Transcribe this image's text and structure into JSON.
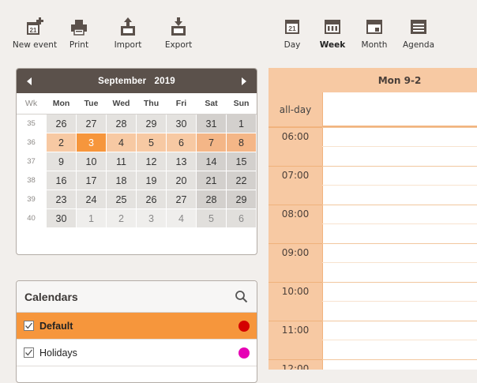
{
  "toolbar_left": [
    {
      "name": "new-event-button",
      "icon": "new-event-icon",
      "label": "New event"
    },
    {
      "name": "print-button",
      "icon": "print-icon",
      "label": "Print"
    },
    {
      "name": "import-button",
      "icon": "import-icon",
      "label": "Import"
    },
    {
      "name": "export-button",
      "icon": "export-icon",
      "label": "Export"
    }
  ],
  "toolbar_right": [
    {
      "name": "view-day-button",
      "icon": "day-view-icon",
      "label": "Day",
      "icon_text": "21",
      "active": false
    },
    {
      "name": "view-week-button",
      "icon": "week-view-icon",
      "label": "Week",
      "active": true
    },
    {
      "name": "view-month-button",
      "icon": "month-view-icon",
      "label": "Month",
      "active": false
    },
    {
      "name": "view-agenda-button",
      "icon": "agenda-view-icon",
      "label": "Agenda",
      "active": false
    }
  ],
  "new_event_icon_text": "21",
  "mini_calendar": {
    "month": "September",
    "year": "2019",
    "prev_icon": "triangle-left-icon",
    "next_icon": "triangle-right-icon",
    "week_label": "Wk",
    "weekdays": [
      "Mon",
      "Tue",
      "Wed",
      "Thu",
      "Fri",
      "Sat",
      "Sun"
    ],
    "weeks": [
      {
        "wk": "35",
        "days": [
          "26",
          "27",
          "28",
          "29",
          "30",
          "31",
          "1"
        ],
        "other": [
          false,
          false,
          false,
          false,
          false,
          false,
          false
        ],
        "current": false
      },
      {
        "wk": "36",
        "days": [
          "2",
          "3",
          "4",
          "5",
          "6",
          "7",
          "8"
        ],
        "other": [
          false,
          false,
          false,
          false,
          false,
          false,
          false
        ],
        "current": true
      },
      {
        "wk": "37",
        "days": [
          "9",
          "10",
          "11",
          "12",
          "13",
          "14",
          "15"
        ],
        "other": [
          false,
          false,
          false,
          false,
          false,
          false,
          false
        ],
        "current": false
      },
      {
        "wk": "38",
        "days": [
          "16",
          "17",
          "18",
          "19",
          "20",
          "21",
          "22"
        ],
        "other": [
          false,
          false,
          false,
          false,
          false,
          false,
          false
        ],
        "current": false
      },
      {
        "wk": "39",
        "days": [
          "23",
          "24",
          "25",
          "26",
          "27",
          "28",
          "29"
        ],
        "other": [
          false,
          false,
          false,
          false,
          false,
          false,
          false
        ],
        "current": false
      },
      {
        "wk": "40",
        "days": [
          "30",
          "1",
          "2",
          "3",
          "4",
          "5",
          "6"
        ],
        "other": [
          false,
          true,
          true,
          true,
          true,
          true,
          true
        ],
        "current": false
      }
    ],
    "selected_day": "3"
  },
  "calendars_panel": {
    "title": "Calendars",
    "search_icon": "search-icon",
    "items": [
      {
        "label": "Default",
        "checked": true,
        "active": true,
        "color": "#d40000"
      },
      {
        "label": "Holidays",
        "checked": true,
        "active": false,
        "color": "#e600b4"
      }
    ]
  },
  "week_view": {
    "day_header": "Mon 9-2",
    "allday_label": "all-day",
    "hours": [
      "06:00",
      "07:00",
      "08:00",
      "09:00",
      "10:00",
      "11:00",
      "12:00"
    ]
  },
  "colors": {
    "accent": "#f6963c",
    "accent_light": "#f7c9a3",
    "header_dark": "#5b514b"
  }
}
